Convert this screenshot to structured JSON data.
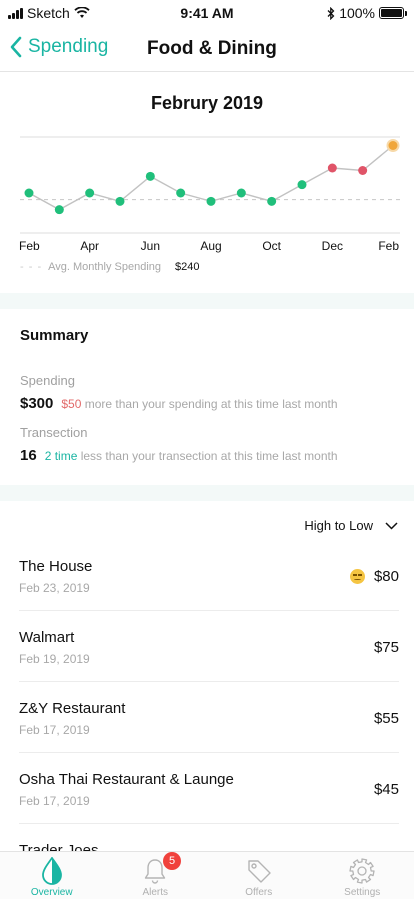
{
  "status_bar": {
    "carrier": "Sketch",
    "time": "9:41 AM",
    "battery": "100%"
  },
  "nav": {
    "back_label": "Spending",
    "title": "Food & Dining"
  },
  "chart_data": {
    "type": "line",
    "title": "Februry 2019",
    "x_ticks": [
      "Feb",
      "Apr",
      "Jun",
      "Aug",
      "Oct",
      "Dec",
      "Feb"
    ],
    "x": [
      "Feb",
      "Mar",
      "Apr",
      "May",
      "Jun",
      "Jul",
      "Aug",
      "Sep",
      "Oct",
      "Nov",
      "Dec",
      "Jan",
      "Feb"
    ],
    "values": [
      248,
      228,
      248,
      238,
      268,
      248,
      238,
      248,
      238,
      258,
      278,
      275,
      305
    ],
    "point_colors": [
      "#20bf7b",
      "#20bf7b",
      "#20bf7b",
      "#20bf7b",
      "#20bf7b",
      "#20bf7b",
      "#20bf7b",
      "#20bf7b",
      "#20bf7b",
      "#20bf7b",
      "#e05468",
      "#e05468",
      "#f0a63a"
    ],
    "average": 240,
    "average_label": "Avg. Monthly Spending",
    "average_display": "$240",
    "ylim": [
      200,
      320
    ],
    "grid": true
  },
  "summary": {
    "title": "Summary",
    "spending_label": "Spending",
    "spending_value": "$300",
    "spending_diff": "$50",
    "spending_note": "more than your spending at this time last month",
    "transaction_label": "Transection",
    "transaction_value": "16",
    "transaction_diff": "2 time",
    "transaction_note": "less than your transection at this time last month"
  },
  "sort": {
    "label": "High to Low"
  },
  "transactions": [
    {
      "name": "The House",
      "date": "Feb 23, 2019",
      "amount": "$80",
      "icon": "worried-face-icon"
    },
    {
      "name": "Walmart",
      "date": "Feb 19, 2019",
      "amount": "$75"
    },
    {
      "name": "Z&Y Restaurant",
      "date": "Feb 17, 2019",
      "amount": "$55"
    },
    {
      "name": "Osha Thai Restaurant & Launge",
      "date": "Feb 17, 2019",
      "amount": "$45"
    },
    {
      "name": "Trader Joes",
      "date": "",
      "amount": ""
    }
  ],
  "tabs": [
    {
      "label": "Overview",
      "icon": "drop-icon",
      "active": true
    },
    {
      "label": "Alerts",
      "icon": "bell-icon",
      "badge": "5"
    },
    {
      "label": "Offers",
      "icon": "tag-icon"
    },
    {
      "label": "Settings",
      "icon": "gear-icon"
    }
  ],
  "colors": {
    "accent": "#1ab5a3",
    "up": "#e05468",
    "badge": "#f0413c"
  }
}
